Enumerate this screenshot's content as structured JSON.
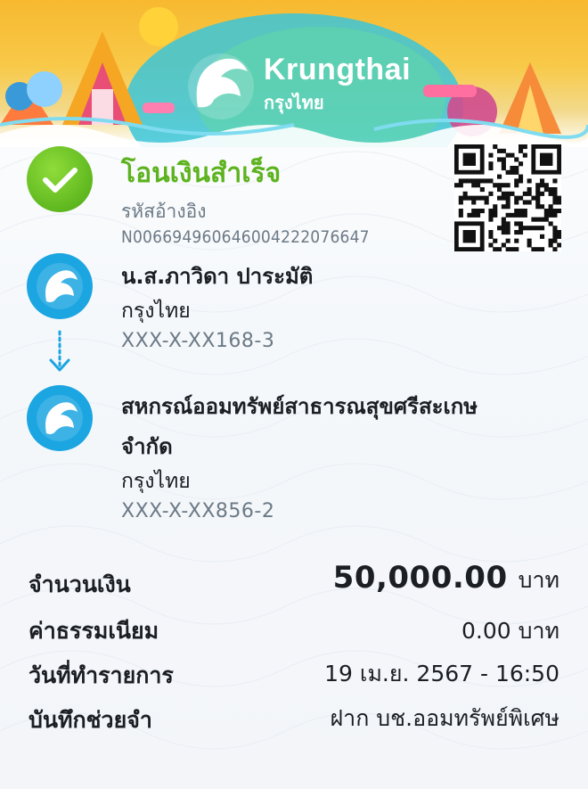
{
  "brand": {
    "name_en": "Krungthai",
    "name_th": "กรุงไทย"
  },
  "status": {
    "title": "โอนเงินสำเร็จ",
    "ref_label": "รหัสอ้างอิง",
    "ref_number": "N006694960646004222076647",
    "icon": "check-icon",
    "color": "#5db31e"
  },
  "sender": {
    "name": "น.ส.ภาวิดา ปาระมัติ",
    "bank": "กรุงไทย",
    "account": "XXX-X-XX168-3"
  },
  "receiver": {
    "name_line1": "สหกรณ์ออมทรัพย์สาธารณสุขศรีสะเกษ",
    "name_line2": "จำกัด",
    "bank": "กรุงไทย",
    "account": "XXX-X-XX856-2"
  },
  "details": {
    "amount_label": "จำนวนเงิน",
    "amount_value": "50,000.00",
    "amount_unit": "บาท",
    "fee_label": "ค่าธรรมเนียม",
    "fee_value": "0.00 บาท",
    "date_label": "วันที่ทำรายการ",
    "date_value": "19 เม.ย. 2567 - 16:50",
    "memo_label": "บันทึกช่วยจำ",
    "memo_value": "ฝาก บช.ออมทรัพย์พิเศษ"
  },
  "colors": {
    "accent": "#1ba5e1",
    "success": "#5db31e",
    "muted": "#6c7a86",
    "text": "#1b1f24"
  }
}
